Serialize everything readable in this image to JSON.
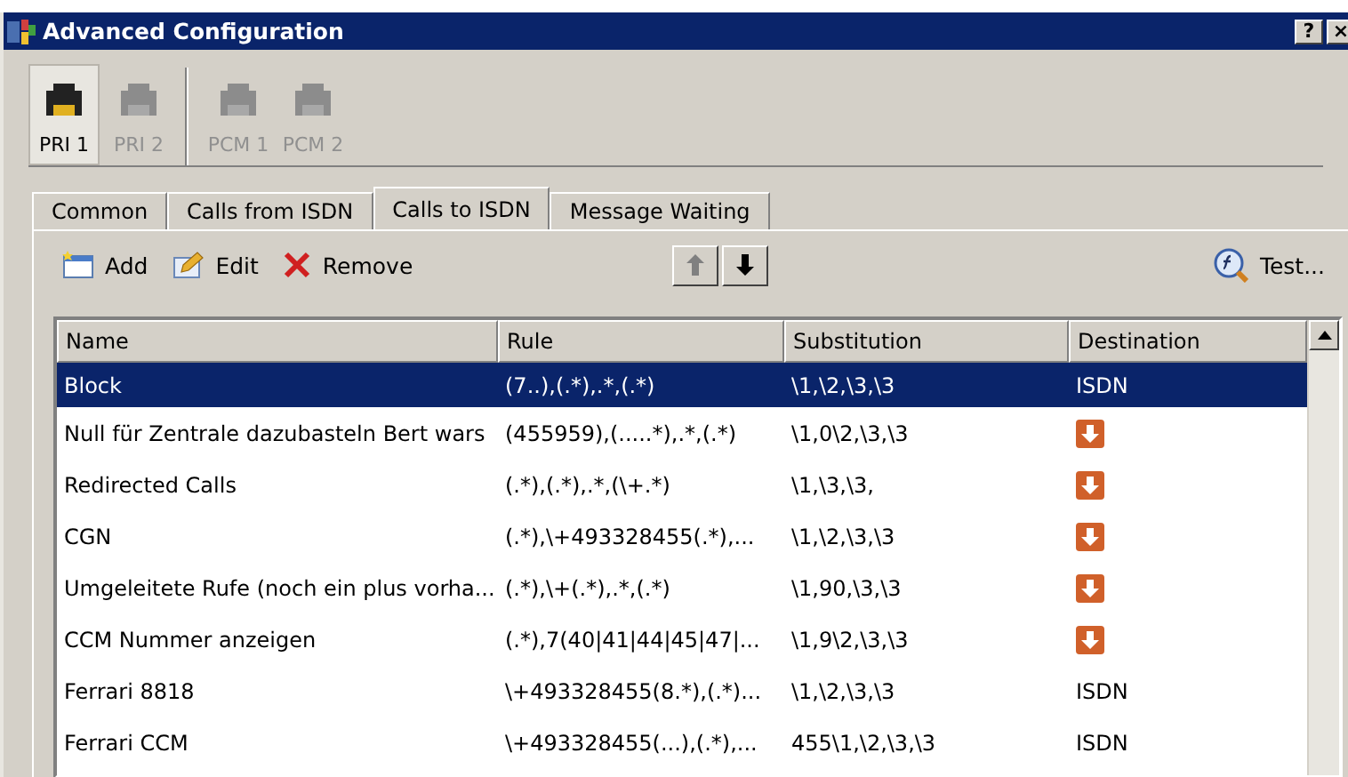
{
  "window": {
    "title": "Advanced Configuration",
    "buttons": [
      "?",
      "×"
    ]
  },
  "port_groups": [
    [
      {
        "label": "PRI 1",
        "selected": true,
        "disabled": false
      },
      {
        "label": "PRI 2",
        "selected": false,
        "disabled": true
      }
    ],
    [
      {
        "label": "PCM 1",
        "selected": false,
        "disabled": true
      },
      {
        "label": "PCM 2",
        "selected": false,
        "disabled": true
      }
    ]
  ],
  "tabs": [
    {
      "label": "Common",
      "selected": false
    },
    {
      "label": "Calls from ISDN",
      "selected": false
    },
    {
      "label": "Calls to ISDN",
      "selected": true
    },
    {
      "label": "Message Waiting",
      "selected": false
    }
  ],
  "toolbar": {
    "actions": [
      {
        "kind": "add",
        "label": "Add"
      },
      {
        "kind": "edit",
        "label": "Edit"
      },
      {
        "kind": "remove",
        "label": "Remove"
      }
    ],
    "move_up": {
      "disabled": true
    },
    "move_down": {
      "disabled": false
    },
    "test": {
      "label": "Test..."
    }
  },
  "table": {
    "columns": [
      "Name",
      "Rule",
      "Substitution",
      "Destination"
    ],
    "rows": [
      {
        "name": "Block",
        "rule": "(7..),(.*),.*,(.*)",
        "substitution": "\\1,\\2,\\3,\\3",
        "destination": {
          "kind": "text",
          "text": "ISDN"
        },
        "selected": true
      },
      {
        "name": "Null für Zentrale dazubasteln Bert wars",
        "rule": "(455959),(.....*),.*,(.*)",
        "substitution": "\\1,0\\2,\\3,\\3",
        "destination": {
          "kind": "icon"
        },
        "selected": false
      },
      {
        "name": "Redirected Calls",
        "rule": "(.*),(.*),.*,(\\+.*)",
        "substitution": "\\1,\\3,\\3,",
        "destination": {
          "kind": "icon"
        },
        "selected": false
      },
      {
        "name": "CGN",
        "rule": "(.*),\\+493328455(.*),...",
        "substitution": "\\1,\\2,\\3,\\3",
        "destination": {
          "kind": "icon"
        },
        "selected": false
      },
      {
        "name": "Umgeleitete Rufe (noch ein plus vorha...",
        "rule": "(.*),\\+(.*),.*,(.*)",
        "substitution": "\\1,90,\\3,\\3",
        "destination": {
          "kind": "icon"
        },
        "selected": false
      },
      {
        "name": "CCM Nummer anzeigen",
        "rule": "(.*),7(40|41|44|45|47|...",
        "substitution": "\\1,9\\2,\\3,\\3",
        "destination": {
          "kind": "icon"
        },
        "selected": false
      },
      {
        "name": "Ferrari 8818",
        "rule": "\\+493328455(8.*),(.*)...",
        "substitution": "\\1,\\2,\\3,\\3",
        "destination": {
          "kind": "text",
          "text": "ISDN"
        },
        "selected": false
      },
      {
        "name": "Ferrari CCM",
        "rule": "\\+493328455(...),(.*),...",
        "substitution": "455\\1,\\2,\\3,\\3",
        "destination": {
          "kind": "text",
          "text": "ISDN"
        },
        "selected": false
      }
    ]
  }
}
